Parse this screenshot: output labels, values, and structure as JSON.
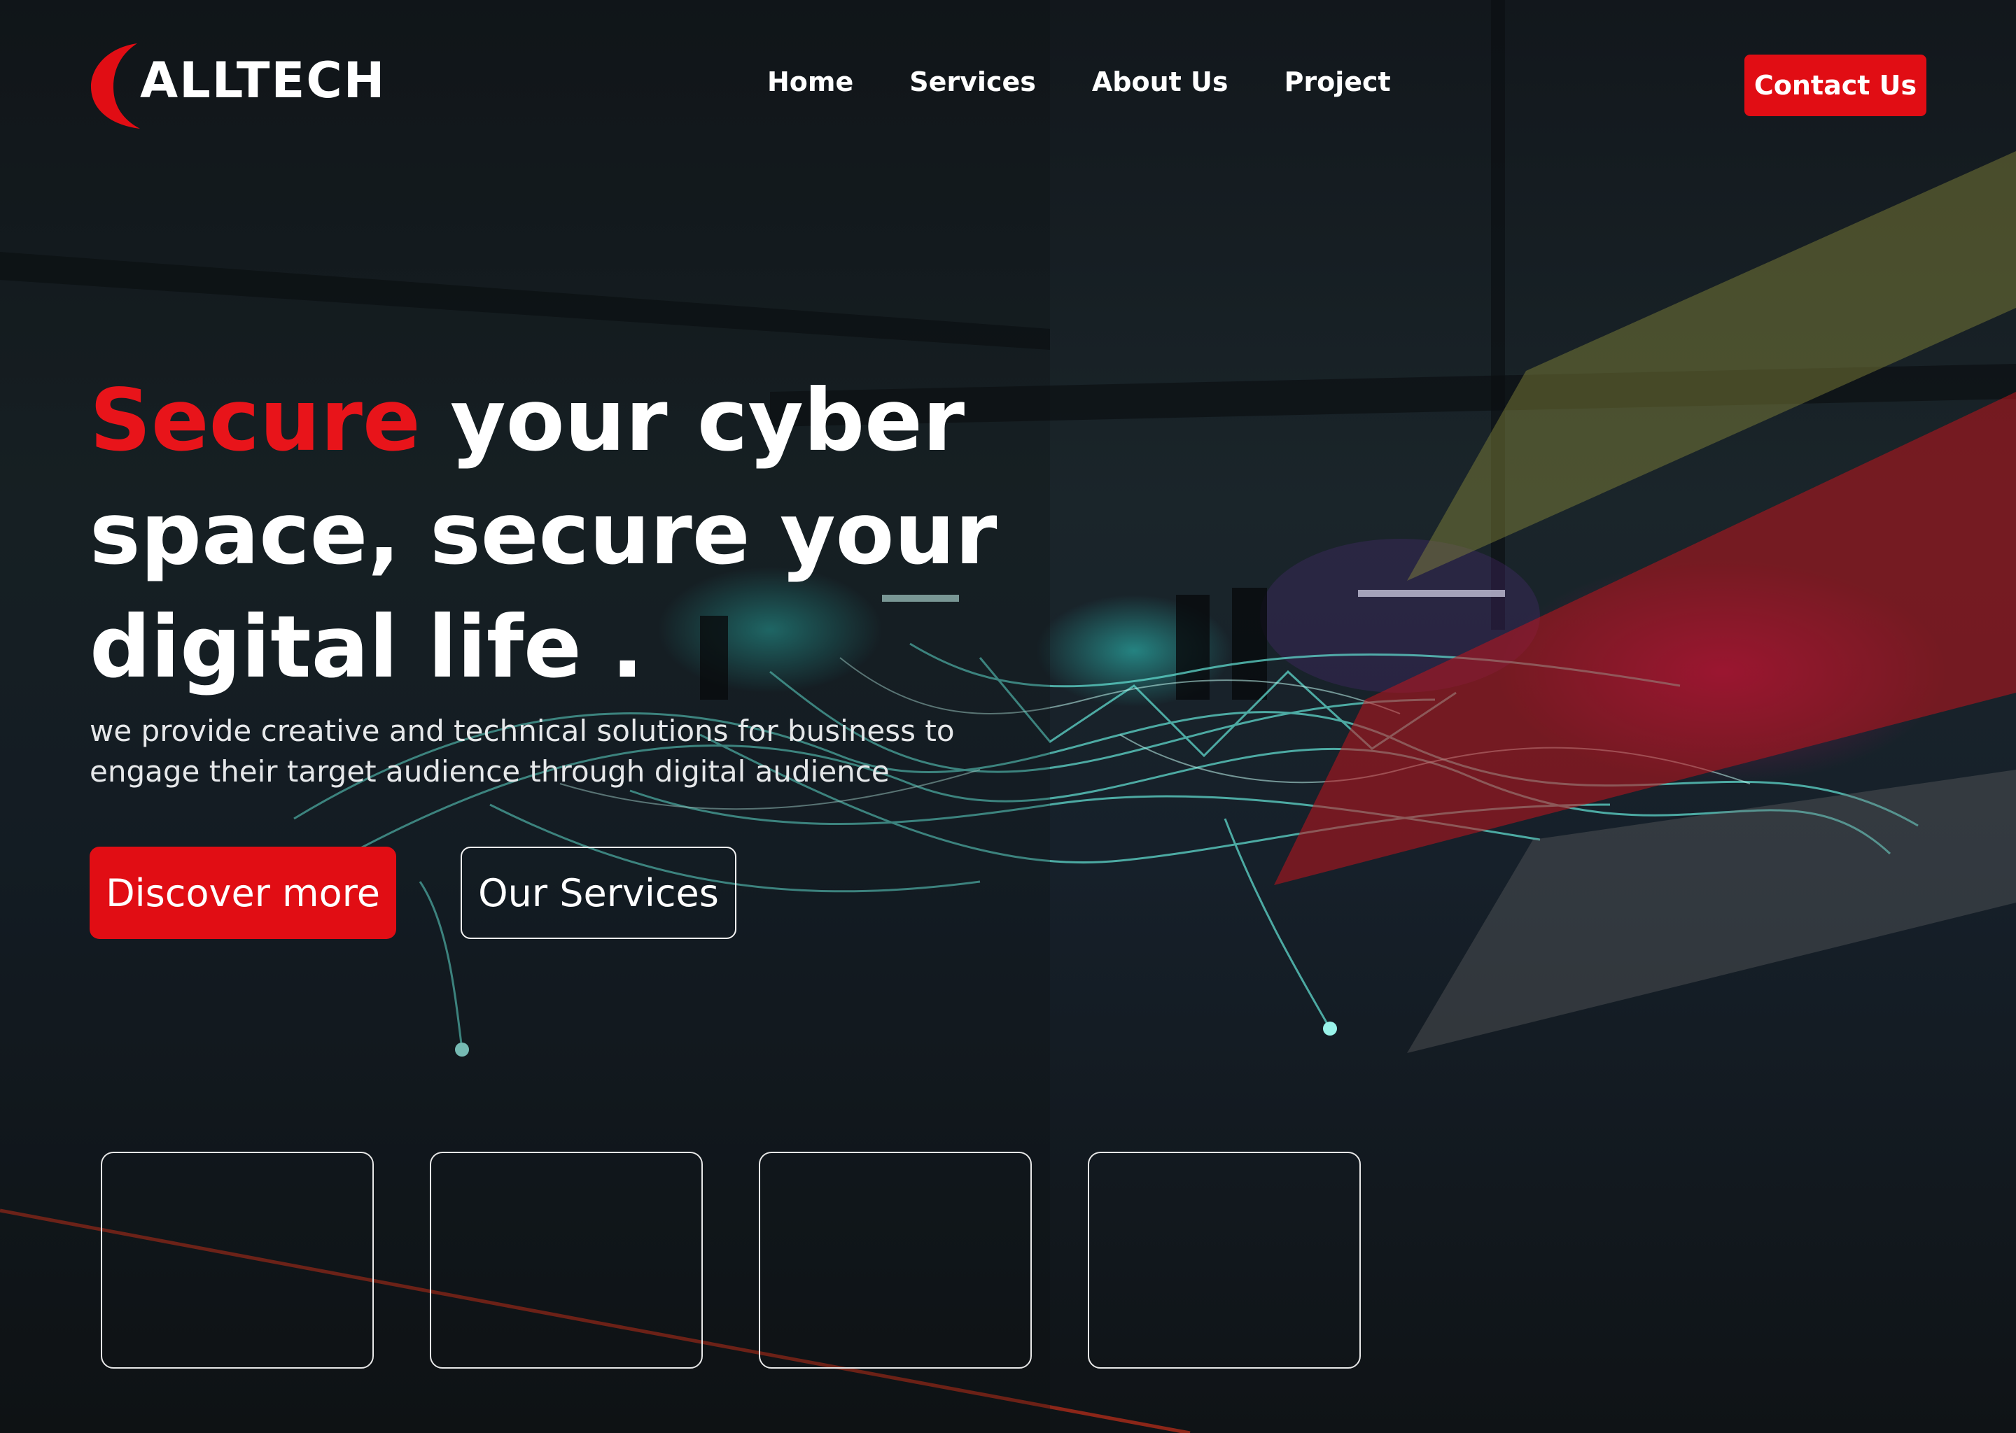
{
  "brand": {
    "name": "ALLTECH",
    "accent_color": "#e10d14"
  },
  "nav": {
    "items": [
      {
        "label": "Home"
      },
      {
        "label": "Services"
      },
      {
        "label": "About Us"
      },
      {
        "label": "Project"
      }
    ],
    "contact_label": "Contact Us"
  },
  "hero": {
    "headline_accent": "Secure",
    "headline_line1_rest": " your cyber",
    "headline_line2": "space, secure your",
    "headline_line3": "digital life .",
    "subtitle": "we provide creative and technical solutions for business to engage their target audience through digital audience",
    "primary_cta": "Discover more",
    "secondary_cta": "Our Services"
  },
  "feature_cards": [
    {},
    {},
    {},
    {}
  ]
}
